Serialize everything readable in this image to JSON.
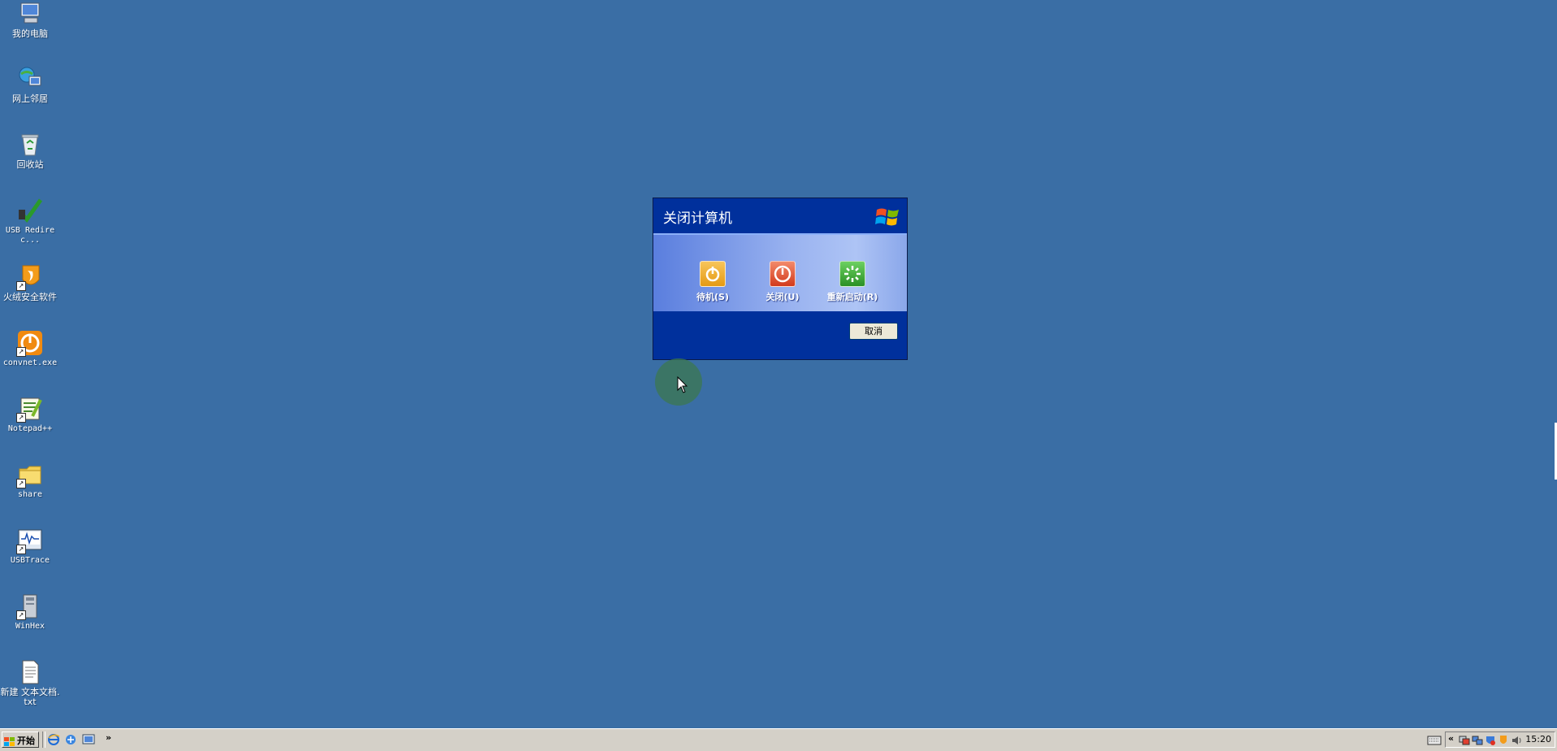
{
  "desktop": {
    "background": "#3a6ea5",
    "icons": [
      {
        "label": "我的电脑",
        "icon": "my-computer-icon"
      },
      {
        "label": "网上邻居",
        "icon": "network-places-icon"
      },
      {
        "label": "回收站",
        "icon": "recycle-bin-icon"
      },
      {
        "label": "USB Redirec...",
        "icon": "usb-redirector-icon"
      },
      {
        "label": "火绒安全软件",
        "icon": "huorong-security-icon"
      },
      {
        "label": "convnet.exe",
        "icon": "convnet-icon"
      },
      {
        "label": "Notepad++",
        "icon": "notepadpp-icon"
      },
      {
        "label": "share",
        "icon": "folder-icon"
      },
      {
        "label": "USBTrace",
        "icon": "usbtrace-icon"
      },
      {
        "label": "WinHex",
        "icon": "winhex-icon"
      },
      {
        "label": "新建 文本文档.txt",
        "icon": "text-file-icon"
      }
    ]
  },
  "dialog": {
    "title": "关闭计算机",
    "options": [
      {
        "label": "待机(S)",
        "color": "#e59a14"
      },
      {
        "label": "关闭(U)",
        "color": "#d23a1c"
      },
      {
        "label": "重新启动(R)",
        "color": "#2a9125"
      }
    ],
    "cancel_label": "取消"
  },
  "taskbar": {
    "start_label": "开始",
    "clock": "15:20"
  }
}
